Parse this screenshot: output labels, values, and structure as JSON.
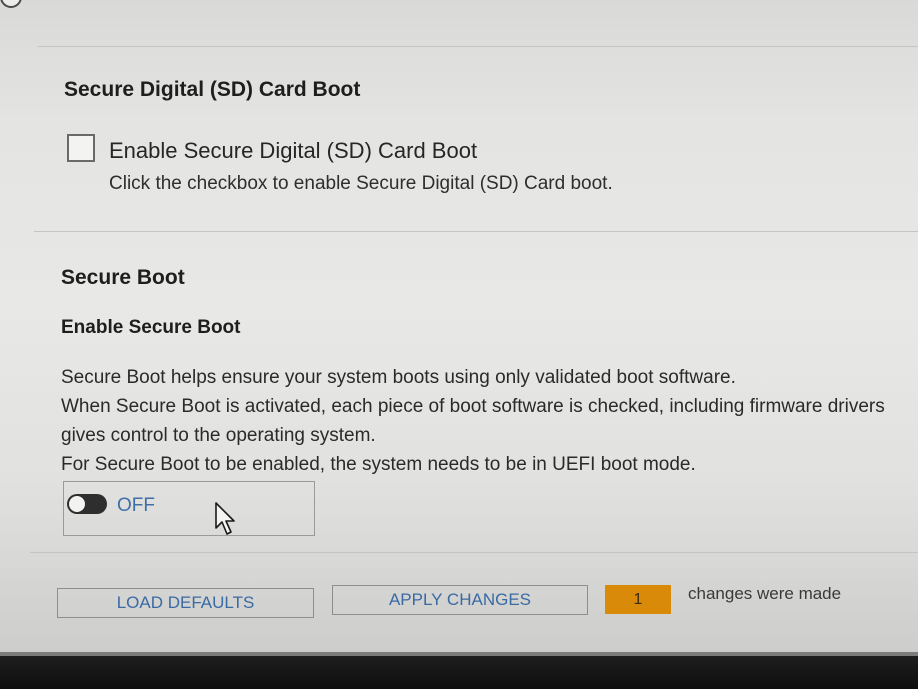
{
  "sd_section": {
    "title": "Secure Digital (SD) Card Boot",
    "checkbox_label": "Enable Secure Digital (SD) Card Boot",
    "checkbox_checked": false,
    "help_text": "Click the checkbox to enable Secure Digital (SD) Card boot."
  },
  "secure_boot": {
    "title": "Secure Boot",
    "subtitle": "Enable Secure Boot",
    "description": [
      "Secure Boot helps ensure your system boots using only validated boot software.",
      "When Secure Boot is activated, each piece of boot software is checked, including firmware drivers",
      "gives control to the operating system.",
      "For Secure Boot to be enabled, the system needs to be in UEFI boot mode."
    ],
    "toggle_state": "OFF"
  },
  "footer": {
    "load_defaults_label": "LOAD DEFAULTS",
    "apply_changes_label": "APPLY CHANGES",
    "changes_count": "1",
    "changes_text": "changes were made"
  },
  "colors": {
    "accent_text": "#3a6aa4",
    "badge": "#d98a08",
    "toggle_off": "#2e2e2e"
  },
  "icons": {
    "cursor": "mouse-pointer-icon",
    "switch": "toggle-switch-off"
  }
}
